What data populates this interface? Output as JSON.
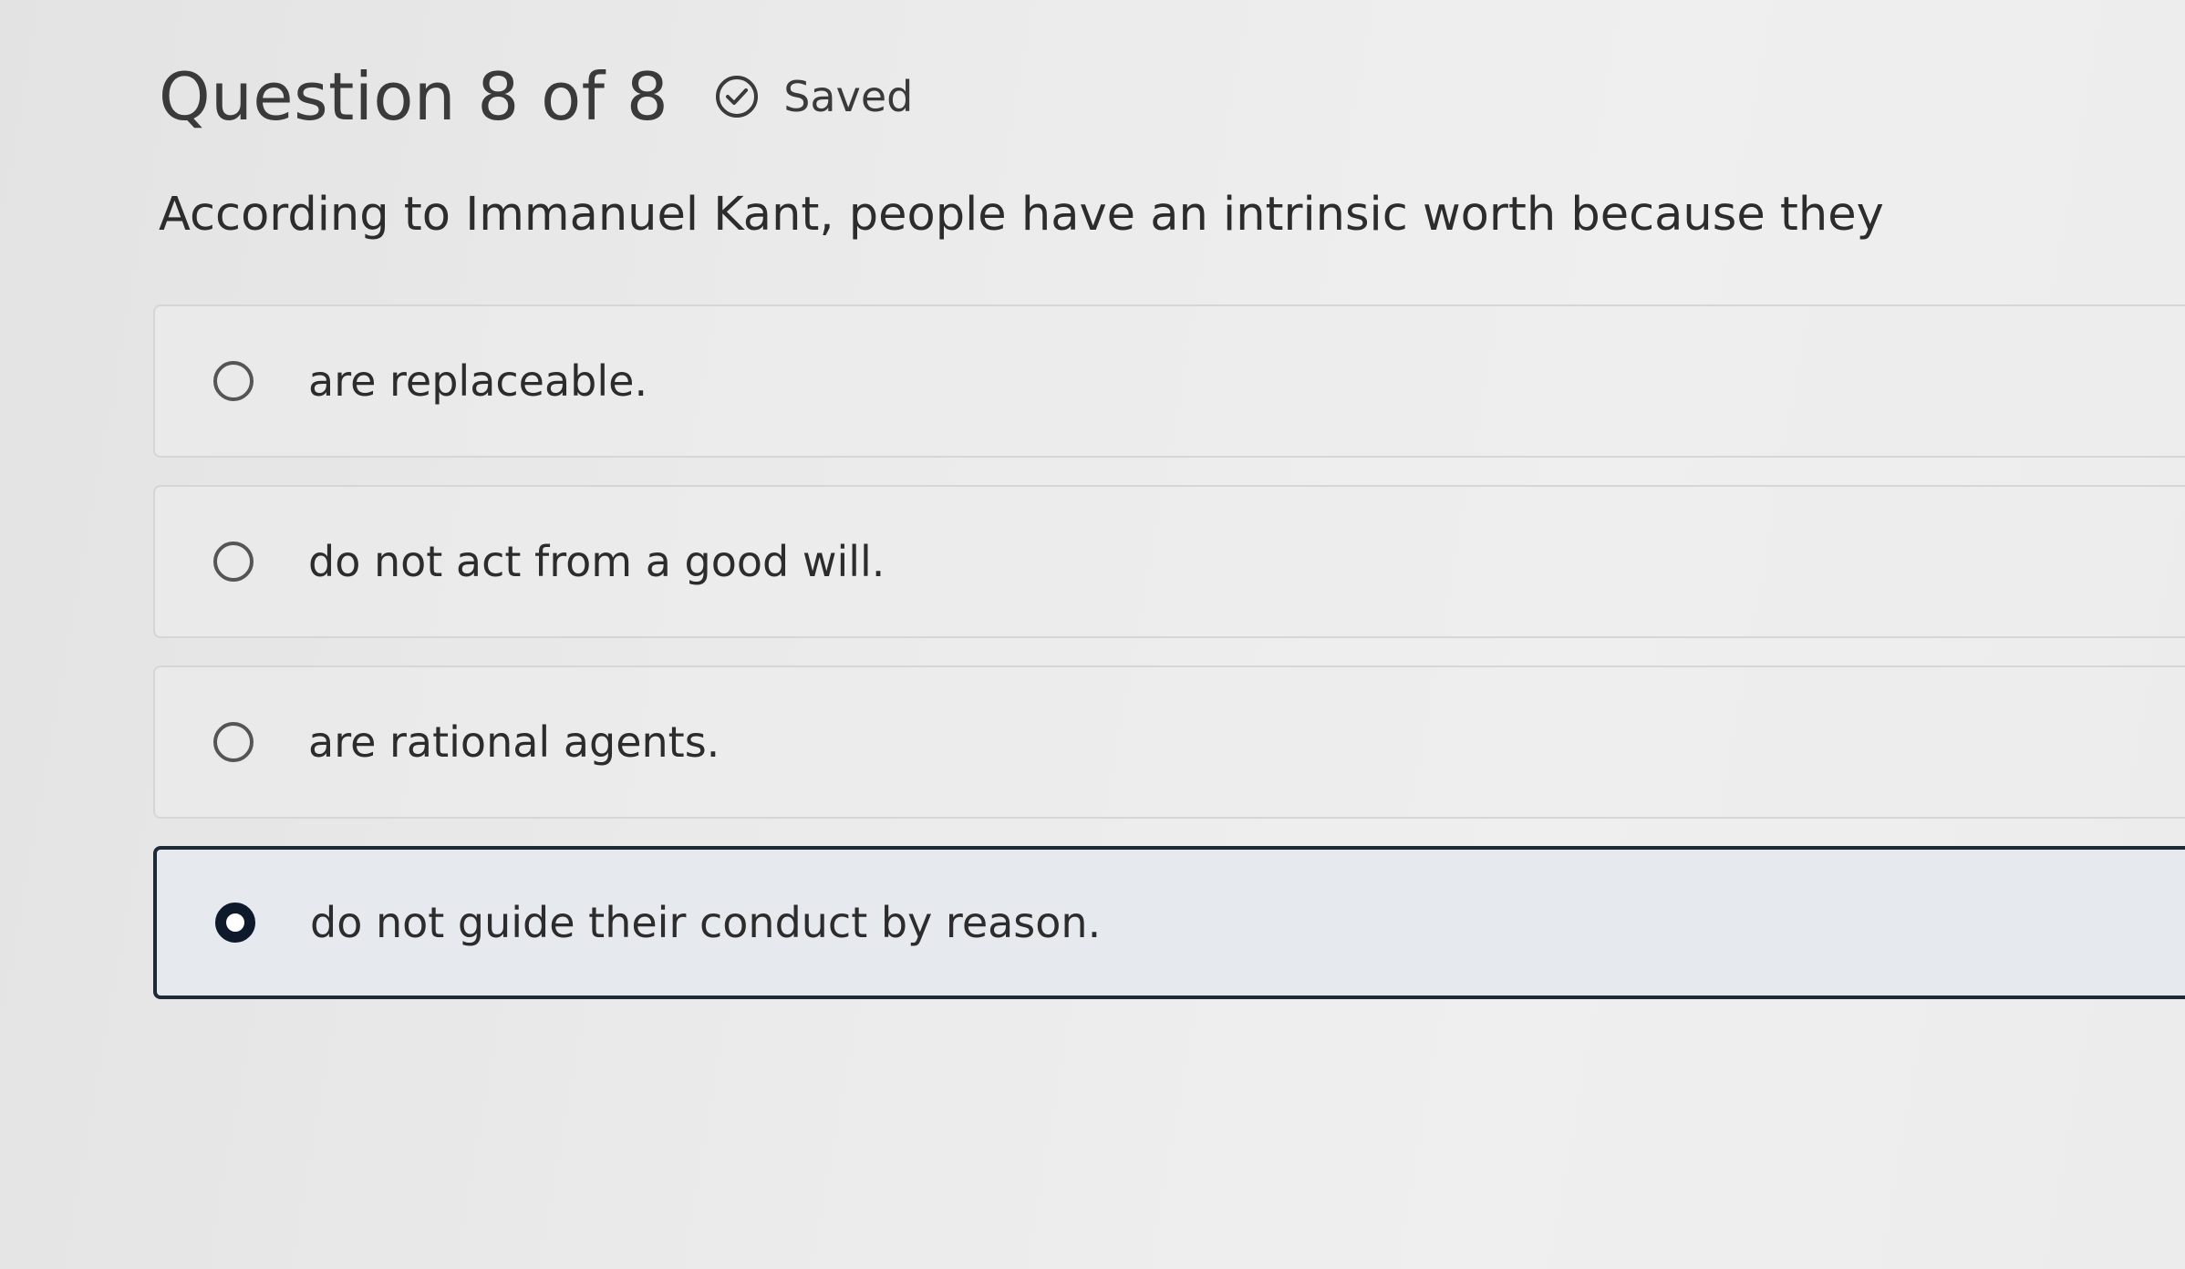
{
  "header": {
    "title": "Question 8 of 8",
    "saved_label": "Saved",
    "saved_icon": "check-circle-icon"
  },
  "question": {
    "text": "According to Immanuel Kant, people have an intrinsic worth because they"
  },
  "options": [
    {
      "label": "are replaceable.",
      "selected": false
    },
    {
      "label": "do not act from a good will.",
      "selected": false
    },
    {
      "label": "are rational agents.",
      "selected": false
    },
    {
      "label": "do not guide their conduct by reason.",
      "selected": true
    }
  ],
  "colors": {
    "selected_border": "#1f2a38",
    "radio_checked": "#0e1a2c"
  }
}
